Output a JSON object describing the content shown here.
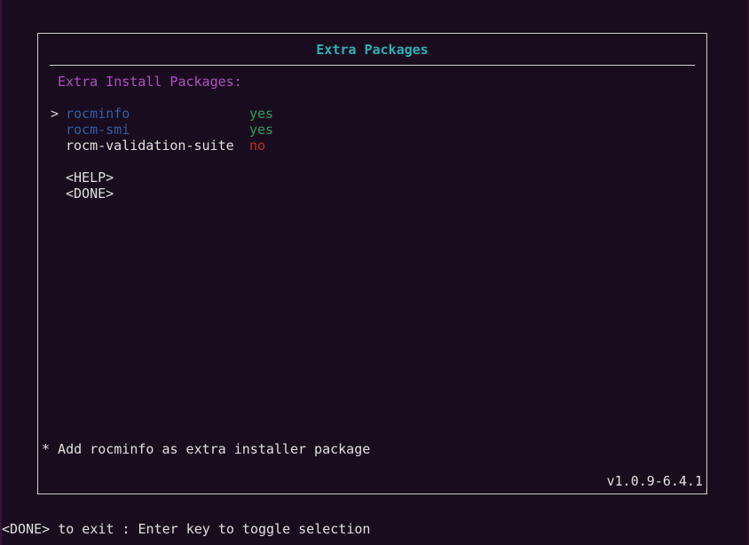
{
  "dialog": {
    "title": "Extra Packages",
    "header": "Extra Install Packages:",
    "cursor": ">",
    "packages": [
      {
        "name": "rocminfo",
        "value": "yes"
      },
      {
        "name": "rocm-smi",
        "value": "yes"
      },
      {
        "name": "rocm-validation-suite",
        "value": "no"
      }
    ],
    "actions": {
      "help": "<HELP>",
      "done": "<DONE>"
    },
    "hint": "* Add rocminfo as extra installer package",
    "version": "v1.0.9-6.4.1"
  },
  "status_bar": {
    "text": "<DONE> to exit : Enter key to toggle selection"
  },
  "colors": {
    "background": "#190c1e",
    "title": "#2bb2b6",
    "header": "#b04fc4",
    "selected_name": "#2f5fa8",
    "yes": "#2e9e5e",
    "no": "#c22b2b",
    "border": "#cfcfcf"
  }
}
